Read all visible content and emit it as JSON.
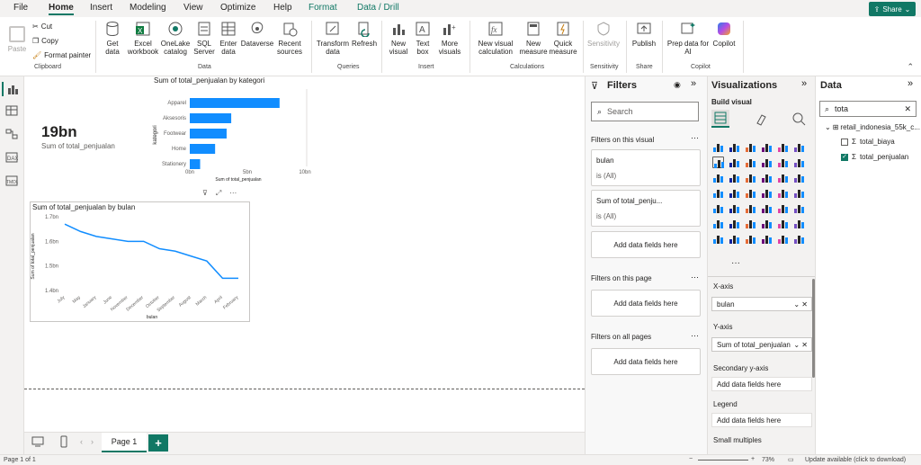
{
  "menu": {
    "items": [
      "File",
      "Home",
      "Insert",
      "Modeling",
      "View",
      "Optimize",
      "Help",
      "Format",
      "Data / Drill"
    ],
    "active": "Home",
    "share_label": "Share"
  },
  "ribbon": {
    "clipboard": {
      "paste": "Paste",
      "cut": "Cut",
      "copy": "Copy",
      "format_painter": "Format painter",
      "group": "Clipboard"
    },
    "data": {
      "get_data": "Get data",
      "excel": "Excel workbook",
      "onelake": "OneLake catalog",
      "sql": "SQL Server",
      "enter": "Enter data",
      "dataverse": "Dataverse",
      "recent": "Recent sources",
      "group": "Data"
    },
    "queries": {
      "transform": "Transform data",
      "refresh": "Refresh",
      "group": "Queries"
    },
    "insert": {
      "new_visual": "New visual",
      "text_box": "Text box",
      "more_visuals": "More visuals",
      "group": "Insert"
    },
    "calculations": {
      "new_visual_calc": "New visual calculation",
      "new_measure": "New measure",
      "quick_measure": "Quick measure",
      "group": "Calculations"
    },
    "sensitivity": {
      "label": "Sensitivity",
      "group": "Sensitivity"
    },
    "share": {
      "publish": "Publish",
      "group": "Share"
    },
    "copilot": {
      "prep": "Prep data for AI",
      "copilot": "Copilot",
      "group": "Copilot"
    }
  },
  "card": {
    "value": "19bn",
    "label": "Sum of total_penjualan"
  },
  "chart_data": [
    {
      "type": "bar",
      "title": "Sum of total_penjualan by kategori",
      "ylabel": "kategori",
      "xlabel": "Sum of total_penjualan",
      "categories": [
        "Apparel",
        "Aksesoris",
        "Footwear",
        "Home",
        "Stationery"
      ],
      "values": [
        7.8,
        3.6,
        3.2,
        2.2,
        0.9
      ],
      "xticks": [
        "0bn",
        "5bn",
        "10bn"
      ],
      "xlim": [
        0,
        10
      ],
      "orientation": "horizontal",
      "color": "#118dff"
    },
    {
      "type": "line",
      "title": "Sum of total_penjualan by bulan",
      "xlabel": "bulan",
      "ylabel": "Sum of total_penjualan",
      "x": [
        "July",
        "May",
        "January",
        "June",
        "November",
        "December",
        "October",
        "September",
        "August",
        "March",
        "April",
        "February"
      ],
      "y": [
        1.67,
        1.64,
        1.62,
        1.61,
        1.6,
        1.6,
        1.57,
        1.56,
        1.54,
        1.52,
        1.45,
        1.45
      ],
      "yticks": [
        "1.4bn",
        "1.5bn",
        "1.6bn",
        "1.7bn"
      ],
      "ylim": [
        1.4,
        1.7
      ],
      "color": "#118dff"
    }
  ],
  "tabs": {
    "page1": "Page 1",
    "add": "+"
  },
  "status": {
    "page": "Page 1 of 1",
    "zoom": "73%",
    "update": "Update available (click to download)"
  },
  "filters": {
    "title": "Filters",
    "search_placeholder": "Search",
    "on_visual": "Filters on this visual",
    "cards": [
      {
        "name": "bulan",
        "value": "is (All)"
      },
      {
        "name": "Sum of total_penju...",
        "value": "is (All)"
      }
    ],
    "add_fields": "Add data fields here",
    "on_page": "Filters on this page",
    "all_pages": "Filters on all pages"
  },
  "viz": {
    "title": "Visualizations",
    "build": "Build visual",
    "xaxis": "X-axis",
    "xaxis_value": "bulan",
    "yaxis": "Y-axis",
    "yaxis_value": "Sum of total_penjualan",
    "secondary": "Secondary y-axis",
    "legend": "Legend",
    "small_multiples": "Small multiples",
    "add_fields": "Add data fields here",
    "more": "···"
  },
  "data": {
    "title": "Data",
    "search_value": "tota",
    "table": "retail_indonesia_55k_c...",
    "fields": [
      {
        "name": "total_biaya",
        "checked": false
      },
      {
        "name": "total_penjualan",
        "checked": true
      }
    ]
  }
}
